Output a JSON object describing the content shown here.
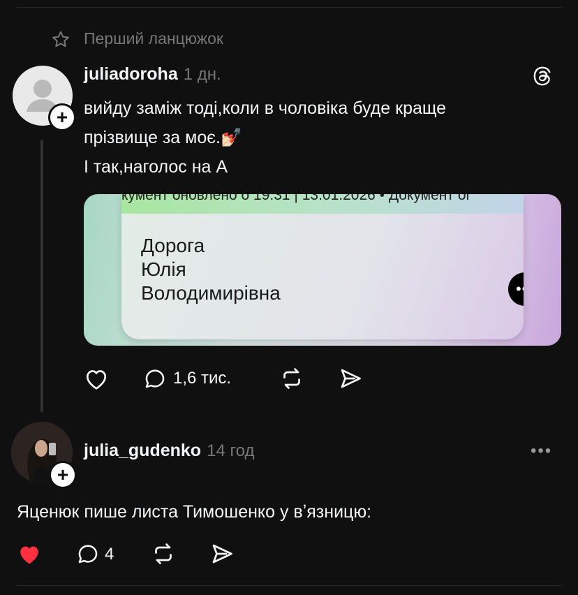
{
  "thread_header": {
    "label": "Перший ланцюжок",
    "icon": "star-icon"
  },
  "post1": {
    "username": "juliadoroha",
    "time": "1 дн.",
    "text_line1": "вийду заміж тоді,коли в чоловіка буде краще",
    "text_line2": "прізвище за моє.💅🏻",
    "text_line3": "І так,наголос на А",
    "image": {
      "strip_text": "кумент оновлено о 19:31 | 13.01.2026 • Документ ог",
      "name_lines": [
        "Дорога",
        "Юлія",
        "Володимирівна"
      ]
    },
    "actions": {
      "replies": "1,6 тис."
    }
  },
  "post2": {
    "username": "julia_gudenko",
    "time": "14 год",
    "text": "Яценюк пише листа Тимошенко у вʼязницю:",
    "actions": {
      "replies": "4",
      "liked": true
    }
  },
  "colors": {
    "background": "#101010",
    "muted": "#777777",
    "like": "#ff3040"
  }
}
